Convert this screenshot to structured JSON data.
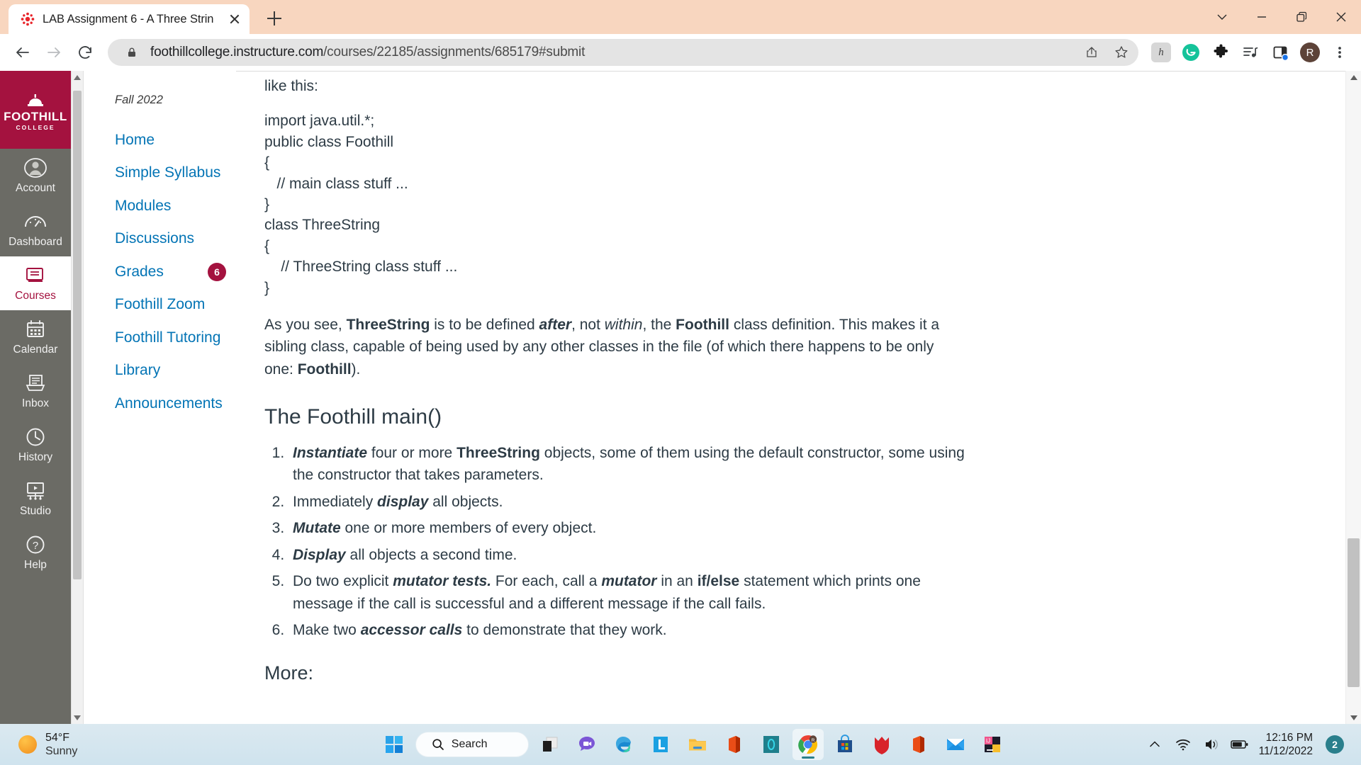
{
  "browser": {
    "tab": {
      "title": "LAB Assignment 6 - A Three Strin",
      "favicon": "canvas-icon",
      "close": "close-icon"
    },
    "new_tab_label": "+",
    "window_controls": {
      "minimize_group": "chevron-down-icon",
      "minimize": "minimize-icon",
      "maximize": "restore-icon",
      "close": "close-icon"
    },
    "nav": {
      "back": "back-arrow-icon",
      "forward": "forward-arrow-icon",
      "reload": "reload-icon"
    },
    "omnibox": {
      "lock": "lock-icon",
      "url_domain": "foothillcollege.instructure.com",
      "url_path": "/courses/22185/assignments/685179#submit",
      "url_full": "foothillcollege.instructure.com/courses/22185/assignments/685179#submit",
      "share": "share-icon",
      "bookmark": "star-icon"
    },
    "extensions": [
      {
        "name": "honey-extension-icon",
        "label": "h"
      },
      {
        "name": "grammarly-extension-icon",
        "label": "G"
      },
      {
        "name": "extensions-puzzle-icon",
        "label": ""
      },
      {
        "name": "media-playlist-icon",
        "label": ""
      },
      {
        "name": "side-panel-icon",
        "label": ""
      }
    ],
    "profile": {
      "name": "profile-avatar",
      "initial": "R"
    },
    "menu": "three-dot-menu-icon"
  },
  "globalnav": {
    "logo": {
      "wordmark": "FOOTHILL",
      "sub": "COLLEGE"
    },
    "items": [
      {
        "label": "Account",
        "icon": "account-avatar-icon",
        "active": false
      },
      {
        "label": "Dashboard",
        "icon": "dashboard-gauge-icon",
        "active": false
      },
      {
        "label": "Courses",
        "icon": "courses-book-icon",
        "active": true
      },
      {
        "label": "Calendar",
        "icon": "calendar-icon",
        "active": false
      },
      {
        "label": "Inbox",
        "icon": "inbox-tray-icon",
        "active": false
      },
      {
        "label": "History",
        "icon": "history-clock-icon",
        "active": false
      },
      {
        "label": "Studio",
        "icon": "studio-video-icon",
        "active": false
      },
      {
        "label": "Help",
        "icon": "help-question-icon",
        "active": false
      }
    ]
  },
  "coursenav": {
    "term": "Fall 2022",
    "items": [
      {
        "label": "Home",
        "badge": ""
      },
      {
        "label": "Simple Syllabus",
        "badge": ""
      },
      {
        "label": "Modules",
        "badge": ""
      },
      {
        "label": "Discussions",
        "badge": ""
      },
      {
        "label": "Grades",
        "badge": "6"
      },
      {
        "label": "Foothill Zoom",
        "badge": ""
      },
      {
        "label": "Foothill Tutoring",
        "badge": ""
      },
      {
        "label": "Library",
        "badge": ""
      },
      {
        "label": "Announcements",
        "badge": ""
      }
    ]
  },
  "content": {
    "intro_line": "like this:",
    "code_lines": [
      "import java.util.*;",
      "public class Foothill",
      "{",
      "   // main class stuff ...",
      "}",
      "class ThreeString",
      "{",
      "    // ThreeString class stuff ...",
      "}"
    ],
    "paragraph": {
      "p1": "As you see, ",
      "b1": "ThreeString",
      "p2": " is to be defined ",
      "i1": "after",
      "p3": ", not ",
      "i2": "within",
      "p4": ", the ",
      "b2": "Foothill",
      "p5": " class definition. This makes it a sibling class, capable of being used by any other classes in the file  (of which there happens to be only one: ",
      "b3": "Foothill",
      "p6": ")."
    },
    "heading": "The Foothill main()",
    "steps": [
      {
        "lead_i": "Instantiate",
        "t1": " four or more ",
        "lead_b": "ThreeString",
        "t2": " objects, some of them using the default constructor, some using the constructor that takes parameters."
      },
      {
        "lead_i": "",
        "t1": "Immediately ",
        "lead_b": "",
        "t2": "",
        "i_mid": "display",
        "t3": " all objects."
      },
      {
        "lead_i": "Mutate",
        "t1": " one or more members of every object.",
        "lead_b": "",
        "t2": ""
      },
      {
        "lead_i": "Display",
        "t1": " all objects a second time.",
        "lead_b": "",
        "t2": ""
      },
      {
        "lead_i": "",
        "t1": "Do two explicit ",
        "lead_b": "",
        "t2": ""
      },
      {
        "lead_i": "",
        "t1": "Make two ",
        "lead_b": "",
        "t2": ""
      }
    ],
    "step1_full": "Instantiate four or more ThreeString objects, some of them using the default constructor, some using the constructor that takes parameters.",
    "step2_full": "Immediately display all objects.",
    "step3_full": "Mutate one or more members of every object.",
    "step4_full": "Display all objects a second time.",
    "step5_full": "Do two explicit mutator tests. For each, call a mutator in an if/else statement which prints one message if the call is successful and a different message if the call fails.",
    "step6_full": "Make two accessor calls to demonstrate that they work.",
    "more_heading": "More:"
  },
  "taskbar": {
    "weather": {
      "temp": "54°F",
      "condition": "Sunny",
      "icon": "sun-icon"
    },
    "start": "windows-start-icon",
    "search": {
      "label": "Search",
      "icon": "search-icon"
    },
    "apps": [
      {
        "name": "task-view-icon",
        "active": false
      },
      {
        "name": "chat-teams-icon",
        "active": false
      },
      {
        "name": "microsoft-edge-icon",
        "active": false
      },
      {
        "name": "lastpass-icon",
        "active": false
      },
      {
        "name": "file-explorer-icon",
        "active": false
      },
      {
        "name": "office-icon",
        "active": false
      },
      {
        "name": "cortana-icon",
        "active": false
      },
      {
        "name": "google-chrome-icon",
        "active": true
      },
      {
        "name": "microsoft-store-icon",
        "active": false
      },
      {
        "name": "malwarebytes-icon",
        "active": false
      },
      {
        "name": "office-word-icon",
        "active": false
      },
      {
        "name": "mail-icon",
        "active": false
      },
      {
        "name": "intellij-idea-icon",
        "active": false
      }
    ],
    "tray": {
      "overflow": "chevron-up-icon",
      "wifi": "wifi-icon",
      "volume": "speaker-icon",
      "battery": "battery-icon",
      "time": "12:16 PM",
      "date": "11/12/2022",
      "notifications": "2"
    }
  },
  "colors": {
    "tab_strip": "#f8d6bf",
    "canvas_brand": "#a4123f",
    "canvas_nav": "#6b6b65",
    "link_blue": "#0374b5",
    "text": "#2d3b45",
    "taskbar": "#cfe3ee"
  }
}
